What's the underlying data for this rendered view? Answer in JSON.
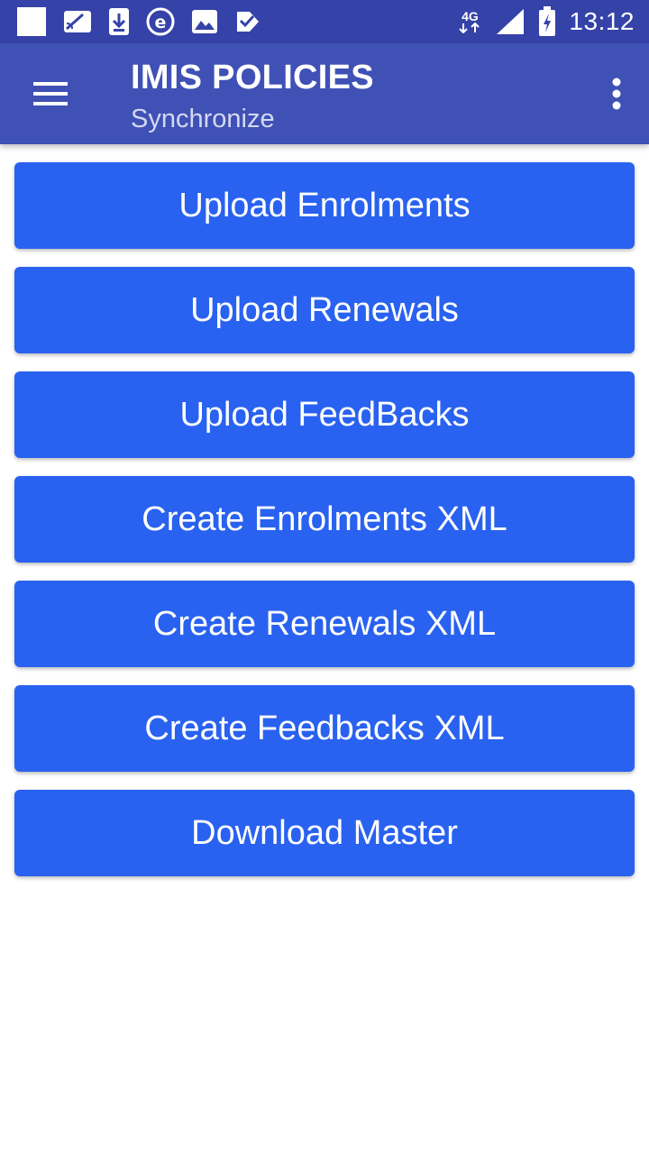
{
  "status_bar": {
    "left_icons": [
      "blank-square-icon",
      "cast-icon",
      "download-icon",
      "e-letter-icon",
      "image-icon",
      "check-tag-icon"
    ],
    "network_label": "4G",
    "time": "13:12"
  },
  "app_bar": {
    "title": "IMIS POLICIES",
    "subtitle": "Synchronize",
    "menu_icon": "hamburger-menu-icon",
    "overflow_icon": "more-vertical-icon"
  },
  "actions": [
    {
      "label": "Upload Enrolments"
    },
    {
      "label": "Upload Renewals"
    },
    {
      "label": "Upload FeedBacks"
    },
    {
      "label": "Create Enrolments XML"
    },
    {
      "label": "Create Renewals XML"
    },
    {
      "label": "Create Feedbacks XML"
    },
    {
      "label": "Download Master"
    }
  ],
  "colors": {
    "status_bar": "#3542a8",
    "app_bar": "#3f51b5",
    "button": "#2962f0",
    "button_text": "#ffffff"
  }
}
